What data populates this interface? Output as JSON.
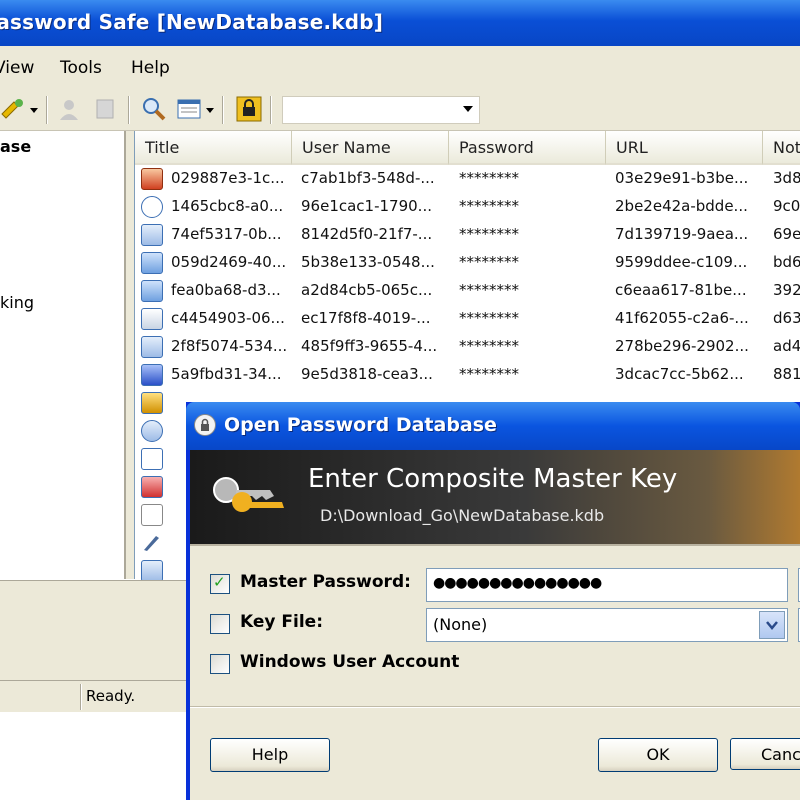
{
  "window": {
    "title": "Password Safe [NewDatabase.kdb]"
  },
  "menu": [
    "View",
    "Tools",
    "Help"
  ],
  "tree": [
    "ase",
    "king"
  ],
  "columns": [
    "Title",
    "User Name",
    "Password",
    "URL",
    "Not"
  ],
  "rows": [
    {
      "title": "029887e3-1c...",
      "user": "c7ab1bf3-548d-...",
      "password": "********",
      "url": "03e29e91-b3be...",
      "notes": "3d8"
    },
    {
      "title": "1465cbc8-a0...",
      "user": "96e1cac1-1790...",
      "password": "********",
      "url": "2be2e42a-bdde...",
      "notes": "9c0"
    },
    {
      "title": "74ef5317-0b...",
      "user": "8142d5f0-21f7-...",
      "password": "********",
      "url": "7d139719-9aea...",
      "notes": "69e"
    },
    {
      "title": "059d2469-40...",
      "user": "5b38e133-0548...",
      "password": "********",
      "url": "9599ddee-c109...",
      "notes": "bd6"
    },
    {
      "title": "fea0ba68-d3...",
      "user": "a2d84cb5-065c...",
      "password": "********",
      "url": "c6eaa617-81be...",
      "notes": "392"
    },
    {
      "title": "c4454903-06...",
      "user": "ec17f8f8-4019-...",
      "password": "********",
      "url": "41f62055-c2a6-...",
      "notes": "d63"
    },
    {
      "title": "2f8f5074-534...",
      "user": "485f9ff3-9655-4...",
      "password": "********",
      "url": "278be296-2902...",
      "notes": "ad4"
    },
    {
      "title": "5a9fbd31-34...",
      "user": "9e5d3818-cea3...",
      "password": "********",
      "url": "3dcac7cc-5b62...",
      "notes": "881"
    }
  ],
  "status": "Ready.",
  "dialog": {
    "title": "Open Password Database",
    "heading": "Enter Composite Master Key",
    "path": "D:\\Download_Go\\NewDatabase.kdb",
    "master_password_label": "Master Password:",
    "master_password_value": "●●●●●●●●●●●●●●●",
    "key_file_label": "Key File:",
    "key_file_value": "(None)",
    "windows_account_label": "Windows User Account",
    "help_button": "Help",
    "ok_button": "OK",
    "cancel_button": "Canc",
    "master_password_checked": true,
    "key_file_checked": false,
    "windows_account_checked": false
  }
}
